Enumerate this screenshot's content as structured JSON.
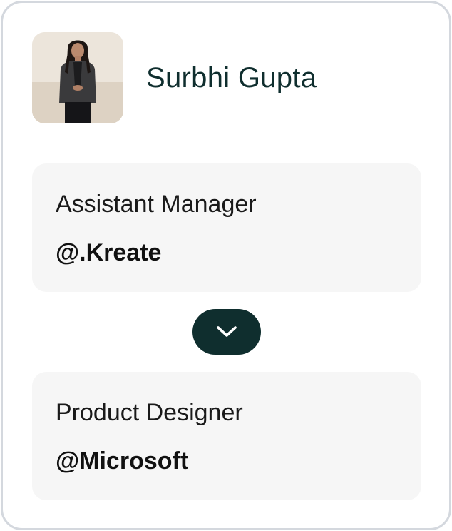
{
  "profile": {
    "name": "Surbhi Gupta",
    "avatar_icon": "person-photo"
  },
  "experience": [
    {
      "title": "Assistant Manager",
      "company": "@.Kreate"
    },
    {
      "title": "Product Designer",
      "company": "@Microsoft"
    }
  ],
  "toggle": {
    "icon": "chevron-down-icon"
  },
  "colors": {
    "accent": "#0f2e2e",
    "card_border": "#d4d8de",
    "panel_bg": "#f6f6f6"
  }
}
